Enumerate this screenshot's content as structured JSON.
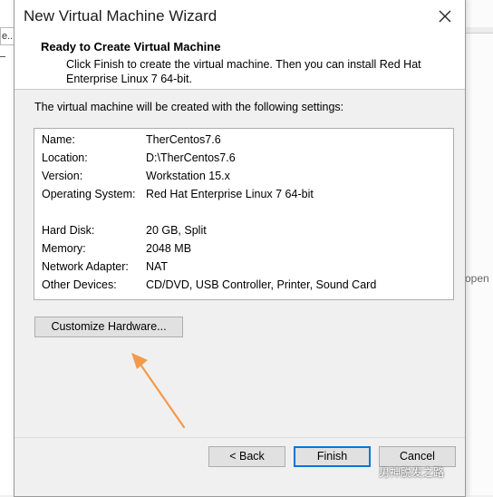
{
  "background": {
    "left_field_text": "e...",
    "right_text": "open"
  },
  "dialog": {
    "title": "New Virtual Machine Wizard",
    "header_title": "Ready to Create Virtual Machine",
    "header_subtitle": "Click Finish to create the virtual machine. Then you can install Red Hat Enterprise Linux 7 64-bit.",
    "intro": "The virtual machine will be created with the following settings:",
    "settings": [
      {
        "label": "Name:",
        "value": "TherCentos7.6"
      },
      {
        "label": "Location:",
        "value": "D:\\TherCentos7.6"
      },
      {
        "label": "Version:",
        "value": "Workstation 15.x"
      },
      {
        "label": "Operating System:",
        "value": "Red Hat Enterprise Linux 7 64-bit"
      },
      {
        "label": "Hard Disk:",
        "value": "20 GB, Split"
      },
      {
        "label": "Memory:",
        "value": "2048 MB"
      },
      {
        "label": "Network Adapter:",
        "value": "NAT"
      },
      {
        "label": "Other Devices:",
        "value": "CD/DVD, USB Controller, Printer, Sound Card"
      }
    ],
    "buttons": {
      "customize": "Customize Hardware...",
      "back": "< Back",
      "finish": "Finish",
      "cancel": "Cancel"
    },
    "close_icon": "close-icon"
  },
  "annotation": {
    "arrow_color": "#f39a4b"
  },
  "watermark": {
    "text": "男神脱发之路"
  },
  "colors": {
    "dialog_bg": "#f0f0f0",
    "header_bg": "#ffffff",
    "finish_border": "#0078d7"
  }
}
